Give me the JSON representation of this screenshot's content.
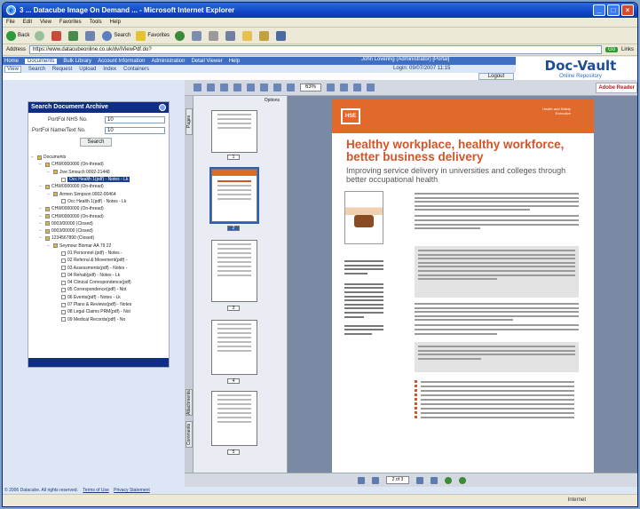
{
  "browser": {
    "title": "3 ... Datacube Image On Demand ... - Microsoft Internet Explorer",
    "menu": [
      "File",
      "Edit",
      "View",
      "Favorites",
      "Tools",
      "Help"
    ],
    "toolbar": {
      "back": "Back",
      "search": "Search",
      "favorites": "Favorites"
    },
    "address_label": "Address",
    "address": "https://www.datacubeonline.co.uk/dv/iViewPdf.do?",
    "go": "Go",
    "links": "Links"
  },
  "app": {
    "nav": [
      "Home",
      "Documents",
      "Bulk Library",
      "Account Information",
      "Administration",
      "Detail Viewer",
      "Help"
    ],
    "nav_selected": "Documents",
    "subnav": [
      "View",
      "Search",
      "Request",
      "Upload",
      "Index",
      "Containers"
    ],
    "subnav_selected": "View",
    "user": "John Lovering (Administrator) [Portal]",
    "login": "Login: 09/07/2007 11:15",
    "logout": "Logout",
    "brand": "Doc-Vault",
    "brand_tagline": "Online Repository"
  },
  "search": {
    "title": "Search Document Archive",
    "field1_label": "PortFol NHS No.",
    "field1_value": "10",
    "field2_label": "PortFol Name/Text No.",
    "field2_value": "10",
    "button": "Search",
    "tree": [
      {
        "indent": 0,
        "label": "Documents"
      },
      {
        "indent": 1,
        "label": "CHW0000000 (On-thread)"
      },
      {
        "indent": 2,
        "label": "Jive Smouch 0002-21448"
      },
      {
        "indent": 3,
        "label": "Occ Health 1(pdf) - Notes - Lk",
        "selected": true
      },
      {
        "indent": 1,
        "label": "CHW0000000 (On-thread)"
      },
      {
        "indent": 2,
        "label": "Armen Simpson 0002-00464"
      },
      {
        "indent": 3,
        "label": "Occ Health 1(pdf) - Notes - Lk"
      },
      {
        "indent": 1,
        "label": "CHW0000000 (On-thread)"
      },
      {
        "indent": 1,
        "label": "CHW0000000 (On-thread)"
      },
      {
        "indent": 1,
        "label": "0003/00000 (Closed)"
      },
      {
        "indent": 1,
        "label": "0003/00000 (Closed)"
      },
      {
        "indent": 1,
        "label": "1234567890 (Closed)"
      },
      {
        "indent": 2,
        "label": "Seymour Bixmar AA 79 22"
      },
      {
        "indent": 3,
        "label": "01 Personnel (pdf) - Notes -"
      },
      {
        "indent": 3,
        "label": "02 Referral & Movement(pdf) -"
      },
      {
        "indent": 3,
        "label": "03 Assessments(pdf) - Notes -"
      },
      {
        "indent": 3,
        "label": "04 Rehab(pdf) - Notes - Lk"
      },
      {
        "indent": 3,
        "label": "04 Clinical Correspondence(pdf)"
      },
      {
        "indent": 3,
        "label": "05 Correspondence(pdf) - Not"
      },
      {
        "indent": 3,
        "label": "06 Events(pdf) - Notes - Lk"
      },
      {
        "indent": 3,
        "label": "07 Plans & Reviews(pdf) - Notes"
      },
      {
        "indent": 3,
        "label": "08 Legal Claims PRM(pdf) - Not"
      },
      {
        "indent": 3,
        "label": "09 Medical Records(pdf) - No"
      }
    ]
  },
  "viewer": {
    "zoom": "63%",
    "pages_label": "Options",
    "page_indicator": "2 of 3",
    "adobe_label": "Adobe Reader",
    "nav_tabs": [
      "Pages",
      "Attachments",
      "Comments"
    ],
    "thumb_pages": [
      "1",
      "2",
      "3",
      "4",
      "5"
    ],
    "selected_page": "2"
  },
  "document": {
    "logo": "HSE",
    "band_text": "Health and Safety Executive",
    "headline": "Healthy workplace, healthy workforce, better business delivery",
    "subhead": "Improving service delivery in universities and colleges through better occupational health"
  },
  "footer": {
    "copyright": "© 2006 Datacube. All rights reserved.",
    "links": [
      "Terms of Use",
      "Privacy Statement"
    ]
  },
  "status": {
    "zone": "Internet"
  }
}
